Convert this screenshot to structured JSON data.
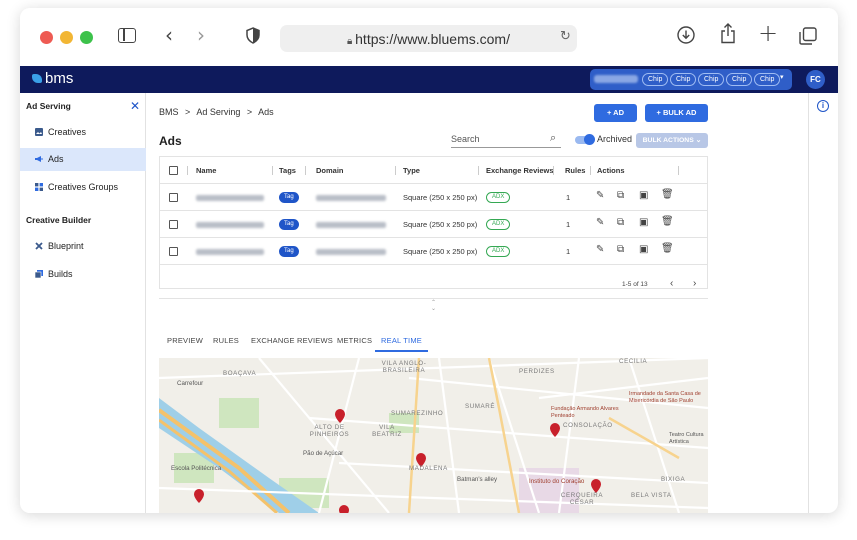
{
  "browser": {
    "url": "https://www.bluems.com/"
  },
  "app": {
    "logo": "bms",
    "account_chips": [
      "Chip",
      "Chip",
      "Chip",
      "Chip",
      "Chip"
    ],
    "avatar_initials": "FC"
  },
  "sidebar": {
    "section_title": "Ad Serving",
    "items": [
      {
        "label": "Creatives",
        "icon": "image-icon"
      },
      {
        "label": "Ads",
        "icon": "megaphone-icon",
        "active": true
      },
      {
        "label": "Creatives Groups",
        "icon": "grid-icon"
      }
    ],
    "section2_title": "Creative Builder",
    "items2": [
      {
        "label": "Blueprint",
        "icon": "tools-icon"
      },
      {
        "label": "Builds",
        "icon": "stack-icon"
      }
    ]
  },
  "breadcrumb": {
    "items": [
      "BMS",
      "Ad Serving",
      "Ads"
    ],
    "separator": ">"
  },
  "toolbar": {
    "add_label": "+ AD",
    "bulk_ad_label": "+ BULK AD",
    "bulk_actions_label": "BULK ACTIONS"
  },
  "page": {
    "title": "Ads",
    "search_placeholder": "Search",
    "archived_label": "Archived",
    "archived_on": true
  },
  "table": {
    "columns": [
      "Name",
      "Tags",
      "Domain",
      "Type",
      "Exchange Reviews",
      "Rules",
      "Actions"
    ],
    "rows": [
      {
        "tag": "Tag",
        "type": "Square (250 x 250 px)",
        "review": "ADX",
        "rules": "1"
      },
      {
        "tag": "Tag",
        "type": "Square (250 x 250 px)",
        "review": "ADX",
        "rules": "1"
      },
      {
        "tag": "Tag",
        "type": "Square (250 x 250 px)",
        "review": "ADX",
        "rules": "1"
      }
    ],
    "pagination": "1-5 of 13"
  },
  "tabs": {
    "items": [
      "PREVIEW",
      "RULES",
      "EXCHANGE REVIEWS",
      "METRICS",
      "REAL TIME"
    ],
    "active": "REAL TIME"
  },
  "map": {
    "labels": [
      "BOAÇAVA",
      "VILA ANGLO-BRASILEIRA",
      "PERDIZES",
      "CECÍLIA",
      "Carrefour",
      "SUMARÉ",
      "SUMAREZINHO",
      "ALTO DE PINHEIROS",
      "VILA BEATRIZ",
      "Fundação Armando Alvares Penteado",
      "Irmandade da Santa Casa de Misericórdia de São Paulo",
      "CONSOLAÇÃO",
      "Teatro Cultura Artística",
      "Pão de Açúcar",
      "Escola Politécnica",
      "MADALENA",
      "Batman's alley",
      "Instituto do Coração",
      "CERQUEIRA CÉSAR",
      "BELA VISTA",
      "BIXIGA"
    ],
    "colors": {
      "water": "#9fcfe8",
      "park": "#cfe6bf",
      "marker": "#c8202b",
      "highway": "#f4c26b"
    }
  }
}
